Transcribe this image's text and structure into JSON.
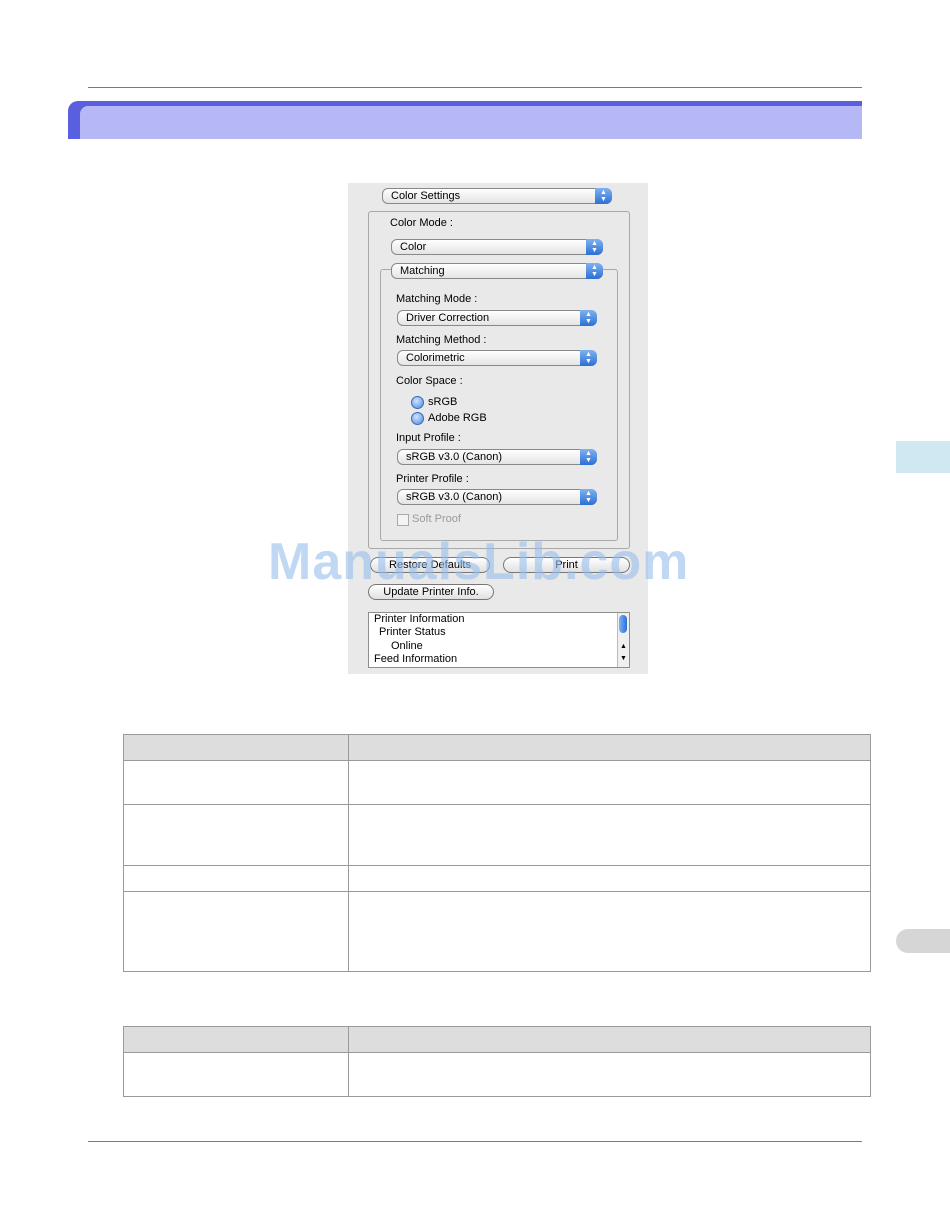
{
  "dialog": {
    "panel_popup": "Color Settings",
    "color_mode_label": "Color Mode :",
    "color_mode_value": "Color",
    "matching_popup": "Matching",
    "matching_mode_label": "Matching Mode :",
    "matching_mode_value": "Driver Correction",
    "matching_method_label": "Matching Method :",
    "matching_method_value": "Colorimetric",
    "color_space_label": "Color Space :",
    "color_space_options": [
      "sRGB",
      "Adobe RGB"
    ],
    "input_profile_label": "Input Profile :",
    "input_profile_value": "sRGB v3.0 (Canon)",
    "printer_profile_label": "Printer Profile :",
    "printer_profile_value": "sRGB v3.0 (Canon)",
    "soft_proof_label": "Soft Proof",
    "restore_button": "Restore Defaults",
    "print_button": "Print",
    "update_button": "Update Printer Info.",
    "info_list": [
      "Printer Information",
      "Printer Status",
      "Online",
      "Feed Information"
    ]
  },
  "watermark": "ManualsLib.com",
  "colors": {
    "banner_dark": "#5a5fe0",
    "banner_light": "#b6b8f6",
    "side_tab": "#cfe8f2",
    "aqua_blue": "#2b6fd6"
  }
}
